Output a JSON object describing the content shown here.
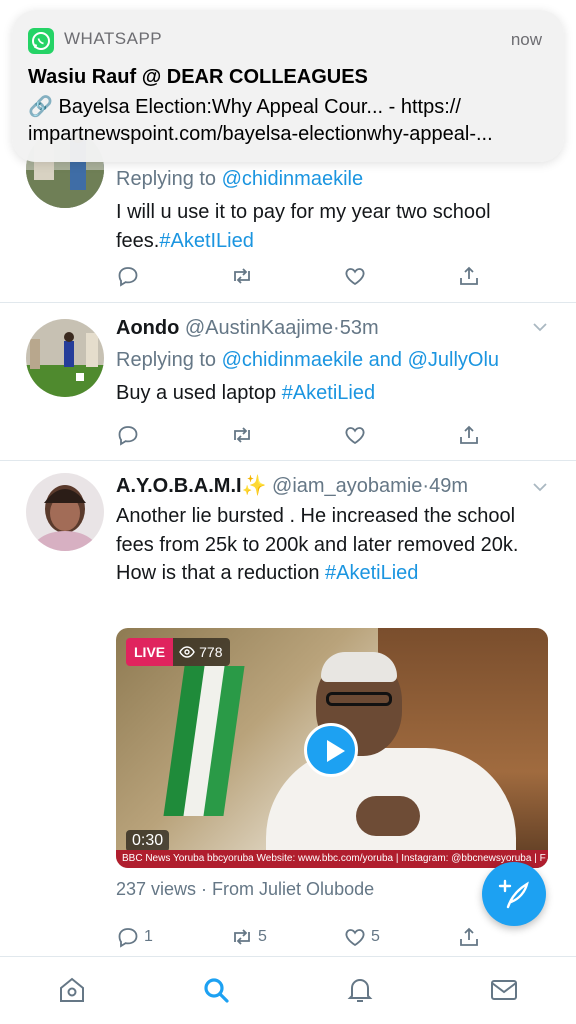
{
  "notification": {
    "app_name": "WHATSAPP",
    "time": "now",
    "title": "Wasiu Rauf @ DEAR COLLEAGUES",
    "body_line1": "🔗 Bayelsa Election:Why Appeal Cour... - https://",
    "body_line2": "impartnewspoint.com/bayelsa-electionwhy-appeal-..."
  },
  "tweets": [
    {
      "replying_prefix": "Replying to ",
      "replying_to": "@chidinmaekile",
      "text_before": "I will u use it to pay for my year two school fees.",
      "hashtag": "#AketILied"
    },
    {
      "display_name": "Aondo",
      "handle": "@AustinKaajime",
      "dot": "·",
      "time": "53m",
      "replying_prefix": "Replying to ",
      "replying_to": "@chidinmaekile and @JullyOlu",
      "text_before": "Buy a used laptop ",
      "hashtag": "#AketiLied"
    },
    {
      "display_name": "A.Y.O.B.A.M.I✨",
      "handle": "@iam_ayobamie",
      "dot": "·",
      "time": "49m",
      "text_before": "Another lie bursted . He increased the school fees from 25k to 200k and later removed 20k. How is that a reduction ",
      "hashtag": "#AketiLied",
      "video": {
        "live_label": "LIVE",
        "viewer_count": "778",
        "duration": "0:30",
        "ticker": "BBC News Yoruba  bbcyoruba   Website: www.bbc.com/yoruba  |  Instagram: @bbcnewsyoruba  |  F"
      },
      "views_line": "237 views · From Juliet Olubode",
      "reply_count": "1",
      "retweet_count": "5",
      "like_count": "5"
    }
  ],
  "tabs": [
    "home",
    "search",
    "notifications",
    "messages"
  ],
  "colors": {
    "accent": "#1da1f2",
    "link": "#1b95e0",
    "secondary_text": "#657786",
    "live": "#e0245e",
    "whatsapp": "#25d366"
  }
}
